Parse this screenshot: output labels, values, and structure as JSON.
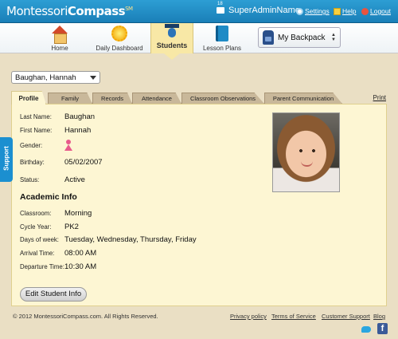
{
  "brand": {
    "name_part1": "Montessori",
    "name_part2": "Compass",
    "tm": "SM"
  },
  "topbar": {
    "user_name": "SuperAdminName",
    "settings": "Settings",
    "help": "Help",
    "logout": "Logout"
  },
  "nav": {
    "items": [
      {
        "label": "Home",
        "icon": "house-icon"
      },
      {
        "label": "Daily Dashboard",
        "icon": "sun-icon"
      },
      {
        "label": "Students",
        "icon": "student-icon",
        "active": true
      },
      {
        "label": "Lesson Plans",
        "icon": "book-icon"
      }
    ],
    "backpack": "My Backpack"
  },
  "student_select": {
    "value": "Baughan, Hannah"
  },
  "tabs": [
    {
      "label": "Profile",
      "active": true
    },
    {
      "label": "Family"
    },
    {
      "label": "Records"
    },
    {
      "label": "Attendance"
    },
    {
      "label": "Classroom Observations"
    },
    {
      "label": "Parent Communication"
    }
  ],
  "print_label": "Print",
  "profile": {
    "last_name_label": "Last Name:",
    "last_name": "Baughan",
    "first_name_label": "First Name:",
    "first_name": "Hannah",
    "gender_label": "Gender:",
    "gender_icon": "female-icon",
    "birthday_label": "Birthday:",
    "birthday": "05/02/2007",
    "status_label": "Status:",
    "status": "Active"
  },
  "academic": {
    "title": "Academic Info",
    "classroom_label": "Classroom:",
    "classroom": "Morning",
    "cycle_label": "Cycle Year:",
    "cycle": "PK2",
    "days_label": "Days of week:",
    "days": "Tuesday, Wednesday, Thursday, Friday",
    "arrival_label": "Arrival Time:",
    "arrival": "08:00 AM",
    "departure_label": "Departure Time:",
    "departure": "10:30 AM"
  },
  "edit_button": "Edit Student Info",
  "support": "Support",
  "footer": {
    "copyright": "© 2012 MontessoriCompass.com. All Rights Reserved.",
    "links": [
      "Privacy policy",
      "Terms of Service",
      "Customer Support",
      "Blog"
    ]
  },
  "colors": {
    "topbar": "#1f8cc6",
    "panel": "#fdf6d3",
    "background": "#eadfc4"
  }
}
